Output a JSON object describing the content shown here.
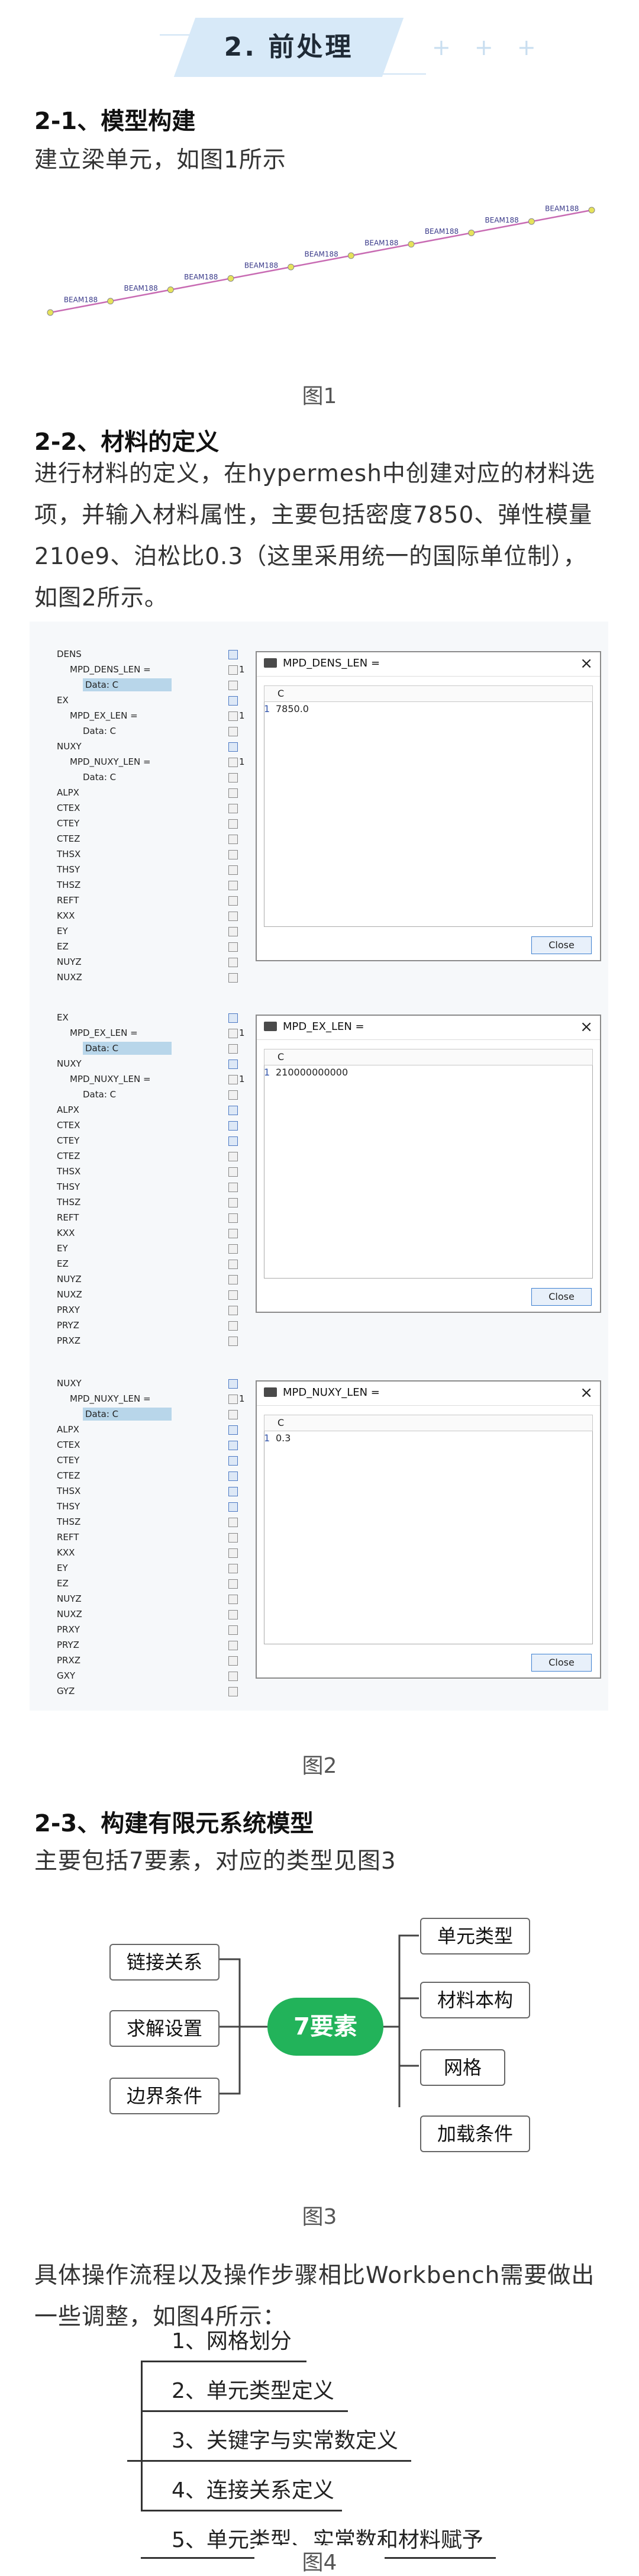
{
  "header": {
    "title": "2. 前处理",
    "decoration": "+ + +"
  },
  "section1": {
    "heading": "2-1、模型构建",
    "text": "建立梁单元，如图1所示",
    "beam_labels": [
      "BEAM188",
      "BEAM188",
      "BEAM188",
      "BEAM188",
      "BEAM188",
      "BEAM188",
      "BEAM188",
      "BEAM188",
      "BEAM188"
    ],
    "caption": "图1"
  },
  "section2": {
    "heading": "2-2、材料的定义",
    "text": "进行材料的定义，在hypermesh中创建对应的材料选项，并输入材料属性，主要包括密度7850、弹性模量210e9、泊松比0.3（这里采用统一的国际单位制），如图2所示。",
    "caption": "图2",
    "panels": [
      {
        "title": "MPD_DENS_LEN =",
        "column": "C",
        "row_num": "1",
        "value": "7850.0",
        "close": "Close",
        "tree": [
          {
            "label": "DENS",
            "indent": 0,
            "sel": false
          },
          {
            "label": "MPD_DENS_LEN =",
            "indent": 1,
            "sel": false,
            "val": "1"
          },
          {
            "label": "Data: C",
            "indent": 2,
            "sel": true
          },
          {
            "label": "EX",
            "indent": 0,
            "sel": false
          },
          {
            "label": "MPD_EX_LEN =",
            "indent": 1,
            "sel": false,
            "val": "1"
          },
          {
            "label": "Data: C",
            "indent": 2,
            "sel": false
          },
          {
            "label": "NUXY",
            "indent": 0,
            "sel": false
          },
          {
            "label": "MPD_NUXY_LEN =",
            "indent": 1,
            "sel": false,
            "val": "1"
          },
          {
            "label": "Data: C",
            "indent": 2,
            "sel": false
          },
          {
            "label": "ALPX",
            "indent": 0,
            "sel": false
          },
          {
            "label": "CTEX",
            "indent": 0,
            "sel": false
          },
          {
            "label": "CTEY",
            "indent": 0,
            "sel": false
          },
          {
            "label": "CTEZ",
            "indent": 0,
            "sel": false
          },
          {
            "label": "THSX",
            "indent": 0,
            "sel": false
          },
          {
            "label": "THSY",
            "indent": 0,
            "sel": false
          },
          {
            "label": "THSZ",
            "indent": 0,
            "sel": false
          },
          {
            "label": "REFT",
            "indent": 0,
            "sel": false
          },
          {
            "label": "KXX",
            "indent": 0,
            "sel": false
          },
          {
            "label": "EY",
            "indent": 0,
            "sel": false
          },
          {
            "label": "EZ",
            "indent": 0,
            "sel": false
          },
          {
            "label": "NUYZ",
            "indent": 0,
            "sel": false
          },
          {
            "label": "NUXZ",
            "indent": 0,
            "sel": false
          }
        ]
      },
      {
        "title": "MPD_EX_LEN =",
        "column": "C",
        "row_num": "1",
        "value": "210000000000",
        "close": "Close",
        "tree": [
          {
            "label": "EX",
            "indent": 0,
            "sel": false
          },
          {
            "label": "MPD_EX_LEN =",
            "indent": 1,
            "sel": false,
            "val": "1"
          },
          {
            "label": "Data: C",
            "indent": 2,
            "sel": true
          },
          {
            "label": "NUXY",
            "indent": 0,
            "sel": false
          },
          {
            "label": "MPD_NUXY_LEN =",
            "indent": 1,
            "sel": false,
            "val": "1"
          },
          {
            "label": "Data: C",
            "indent": 2,
            "sel": false
          },
          {
            "label": "ALPX",
            "indent": 0,
            "sel": false
          },
          {
            "label": "CTEX",
            "indent": 0,
            "sel": false
          },
          {
            "label": "CTEY",
            "indent": 0,
            "sel": false
          },
          {
            "label": "CTEZ",
            "indent": 0,
            "sel": false
          },
          {
            "label": "THSX",
            "indent": 0,
            "sel": false
          },
          {
            "label": "THSY",
            "indent": 0,
            "sel": false
          },
          {
            "label": "THSZ",
            "indent": 0,
            "sel": false
          },
          {
            "label": "REFT",
            "indent": 0,
            "sel": false
          },
          {
            "label": "KXX",
            "indent": 0,
            "sel": false
          },
          {
            "label": "EY",
            "indent": 0,
            "sel": false
          },
          {
            "label": "EZ",
            "indent": 0,
            "sel": false
          },
          {
            "label": "NUYZ",
            "indent": 0,
            "sel": false
          },
          {
            "label": "NUXZ",
            "indent": 0,
            "sel": false
          },
          {
            "label": "PRXY",
            "indent": 0,
            "sel": false
          },
          {
            "label": "PRYZ",
            "indent": 0,
            "sel": false
          },
          {
            "label": "PRXZ",
            "indent": 0,
            "sel": false
          }
        ]
      },
      {
        "title": "MPD_NUXY_LEN =",
        "column": "C",
        "row_num": "1",
        "value": "0.3",
        "close": "Close",
        "tree": [
          {
            "label": "NUXY",
            "indent": 0,
            "sel": false
          },
          {
            "label": "MPD_NUXY_LEN =",
            "indent": 1,
            "sel": false,
            "val": "1"
          },
          {
            "label": "Data: C",
            "indent": 2,
            "sel": true
          },
          {
            "label": "ALPX",
            "indent": 0,
            "sel": false
          },
          {
            "label": "CTEX",
            "indent": 0,
            "sel": false
          },
          {
            "label": "CTEY",
            "indent": 0,
            "sel": false
          },
          {
            "label": "CTEZ",
            "indent": 0,
            "sel": false
          },
          {
            "label": "THSX",
            "indent": 0,
            "sel": false
          },
          {
            "label": "THSY",
            "indent": 0,
            "sel": false
          },
          {
            "label": "THSZ",
            "indent": 0,
            "sel": false
          },
          {
            "label": "REFT",
            "indent": 0,
            "sel": false
          },
          {
            "label": "KXX",
            "indent": 0,
            "sel": false
          },
          {
            "label": "EY",
            "indent": 0,
            "sel": false
          },
          {
            "label": "EZ",
            "indent": 0,
            "sel": false
          },
          {
            "label": "NUYZ",
            "indent": 0,
            "sel": false
          },
          {
            "label": "NUXZ",
            "indent": 0,
            "sel": false
          },
          {
            "label": "PRXY",
            "indent": 0,
            "sel": false
          },
          {
            "label": "PRYZ",
            "indent": 0,
            "sel": false
          },
          {
            "label": "PRXZ",
            "indent": 0,
            "sel": false
          },
          {
            "label": "GXY",
            "indent": 0,
            "sel": false
          },
          {
            "label": "GYZ",
            "indent": 0,
            "sel": false
          }
        ]
      }
    ]
  },
  "section3": {
    "heading": "2-3、构建有限元系统模型",
    "text": "主要包括7要素，对应的类型见图3",
    "center": "7要素",
    "left_items": [
      "链接关系",
      "求解设置",
      "边界条件"
    ],
    "right_items": [
      "单元类型",
      "材料本构",
      "网格",
      "加载条件"
    ],
    "caption": "图3"
  },
  "section4": {
    "text": "具体操作流程以及操作步骤相比Workbench需要做出一些调整，如图4所示：",
    "steps": [
      "1、网格划分",
      "2、单元类型定义",
      "3、关键字与实常数定义",
      "4、连接关系定义",
      "5、单元类型、实常数和材料赋予"
    ],
    "caption": "图4"
  },
  "colors": {
    "accent_green": "#22b35a",
    "header_bg": "#d7e9f8",
    "beam_line": "#c86bb3",
    "node": "#e6e35a"
  }
}
